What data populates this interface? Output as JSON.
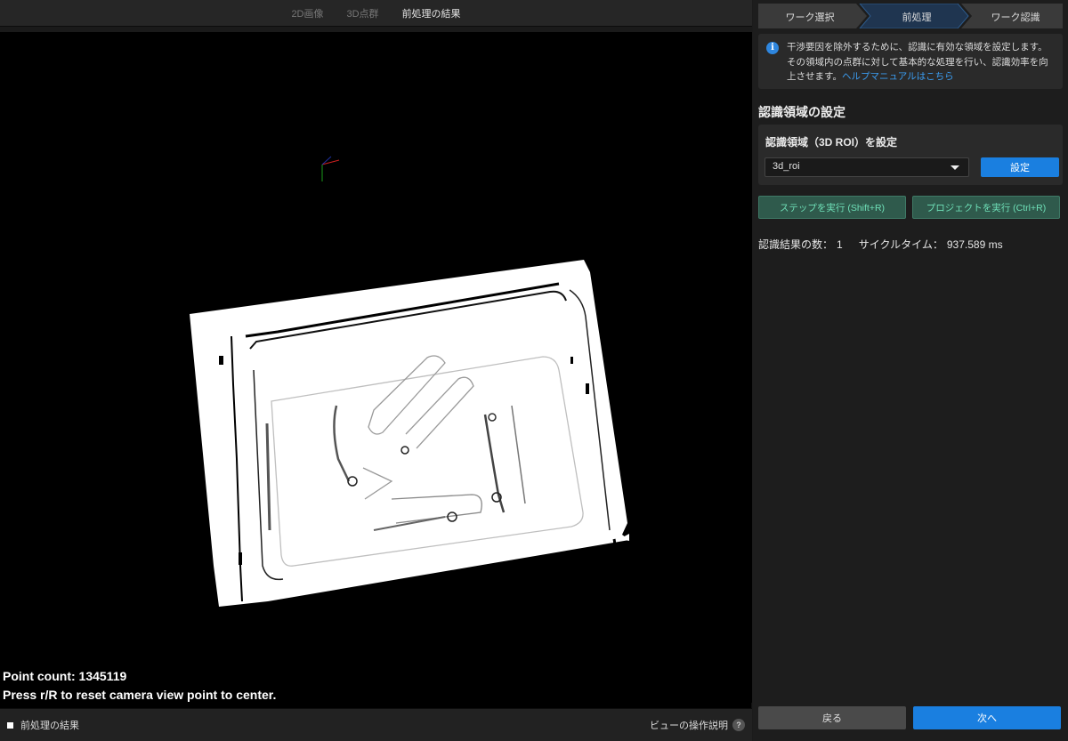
{
  "viewer": {
    "tabs": [
      "2D画像",
      "3D点群",
      "前処理の結果"
    ],
    "active_tab": 2,
    "point_count_text": "Point count: 1345119",
    "reset_hint_text": "Press r/R to reset camera view point to center.",
    "legend_label": "前処理の結果",
    "help_label": "ビューの操作説明",
    "help_icon": "question-icon"
  },
  "panel": {
    "steps": [
      "ワーク選択",
      "前処理",
      "ワーク認識"
    ],
    "active_step": 1,
    "info": {
      "icon": "info-icon",
      "text": "干渉要因を除外するために、認識に有効な領域を設定します。その領域内の点群に対して基本的な処理を行い、認識効率を向上させます。",
      "link": "ヘルプマニュアルはこちら"
    },
    "section_title": "認識領域の設定",
    "roi": {
      "label": "認識領域（3D ROI）を設定",
      "selected": "3d_roi",
      "set_button": "設定"
    },
    "run_step_button": "ステップを実行 (Shift+R)",
    "run_project_button": "プロジェクトを実行 (Ctrl+R)",
    "result": {
      "count_label": "認識結果の数：",
      "count_value": "1",
      "cycle_label": "サイクルタイム：",
      "cycle_value": "937.589 ms"
    },
    "back_button": "戻る",
    "next_button": "次へ"
  },
  "colors": {
    "accent": "#1a7fe0",
    "run_button_text": "#6fe0b8",
    "run_button_bg": "#2f5a4c",
    "active_step_bg": "#1f3550"
  }
}
